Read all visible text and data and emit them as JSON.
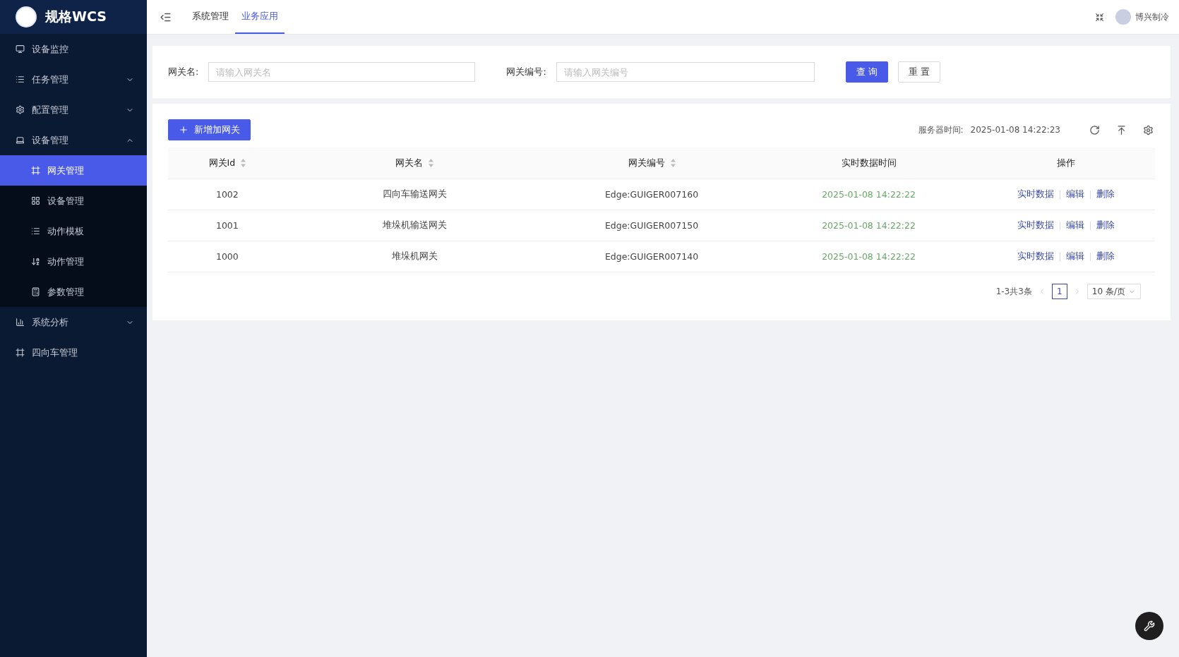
{
  "app": {
    "title": "规格WCS"
  },
  "sidebar": {
    "items": [
      {
        "label": "设备监控",
        "selected": false
      },
      {
        "label": "任务管理",
        "expanded": false,
        "selected": false
      },
      {
        "label": "配置管理",
        "expanded": false,
        "selected": false
      },
      {
        "label": "设备管理",
        "expanded": true,
        "selected": false,
        "children": [
          {
            "label": "网关管理",
            "selected": true
          },
          {
            "label": "设备管理",
            "selected": false
          },
          {
            "label": "动作模板",
            "selected": false
          },
          {
            "label": "动作管理",
            "selected": false
          },
          {
            "label": "参数管理",
            "selected": false
          }
        ]
      },
      {
        "label": "系统分析",
        "expanded": false,
        "selected": false
      },
      {
        "label": "四向车管理",
        "selected": false
      }
    ]
  },
  "header": {
    "tabs": [
      {
        "label": "系统管理",
        "selected": false
      },
      {
        "label": "业务应用",
        "selected": true
      }
    ],
    "user": "博兴制冷"
  },
  "search": {
    "fields": [
      {
        "label": "网关名:",
        "placeholder": "请输入网关名"
      },
      {
        "label": "网关编号:",
        "placeholder": "请输入网关编号"
      }
    ],
    "query_button": "查 询",
    "reset_button": "重 置"
  },
  "toolbar": {
    "add_button": "新增加网关",
    "server_time_label": "服务器时间:",
    "server_time": "2025-01-08 14:22:23"
  },
  "table": {
    "columns": [
      {
        "label": "网关Id",
        "sortable": true
      },
      {
        "label": "网关名",
        "sortable": true
      },
      {
        "label": "网关编号",
        "sortable": true
      },
      {
        "label": "实时数据时间",
        "sortable": false
      },
      {
        "label": "操作",
        "sortable": false
      }
    ],
    "rows": [
      {
        "id": "1002",
        "name": "四向车输送网关",
        "code": "Edge:GUIGER007160",
        "time": "2025-01-08 14:22:22",
        "actions": [
          "实时数据",
          "编辑",
          "删除"
        ]
      },
      {
        "id": "1001",
        "name": "堆垛机输送网关",
        "code": "Edge:GUIGER007150",
        "time": "2025-01-08 14:22:22",
        "actions": [
          "实时数据",
          "编辑",
          "删除"
        ]
      },
      {
        "id": "1000",
        "name": "堆垛机网关",
        "code": "Edge:GUIGER007140",
        "time": "2025-01-08 14:22:22",
        "actions": [
          "实时数据",
          "编辑",
          "删除"
        ]
      }
    ]
  },
  "pagination": {
    "summary": "1-3共3条",
    "pages": [
      {
        "label": "1",
        "selected": true
      }
    ],
    "page_size": "10 条/页"
  }
}
